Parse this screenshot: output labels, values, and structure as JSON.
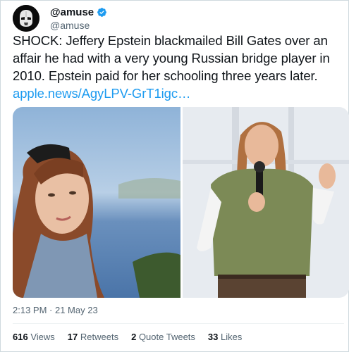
{
  "tweet": {
    "display_name": "@amuse",
    "handle": "@amuse",
    "verified_icon": "verified-badge-icon",
    "text_main": "SHOCK: Jeffery Epstein blackmailed Bill Gates over an affair he had with a very young Russian bridge player in 2010. Epstein paid for her schooling three years later.",
    "link": "apple.news/AgyLPV-GrT1igc…",
    "timestamp": "2:13 PM · 21 May 23",
    "stats": {
      "views_count": "616",
      "views_label": "Views",
      "retweets_count": "17",
      "retweets_label": "Retweets",
      "quotes_count": "2",
      "quotes_label": "Quote Tweets",
      "likes_count": "33",
      "likes_label": "Likes"
    },
    "colors": {
      "link": "#1d9bf0",
      "verified": "#1d9bf0",
      "muted": "#536471"
    }
  }
}
